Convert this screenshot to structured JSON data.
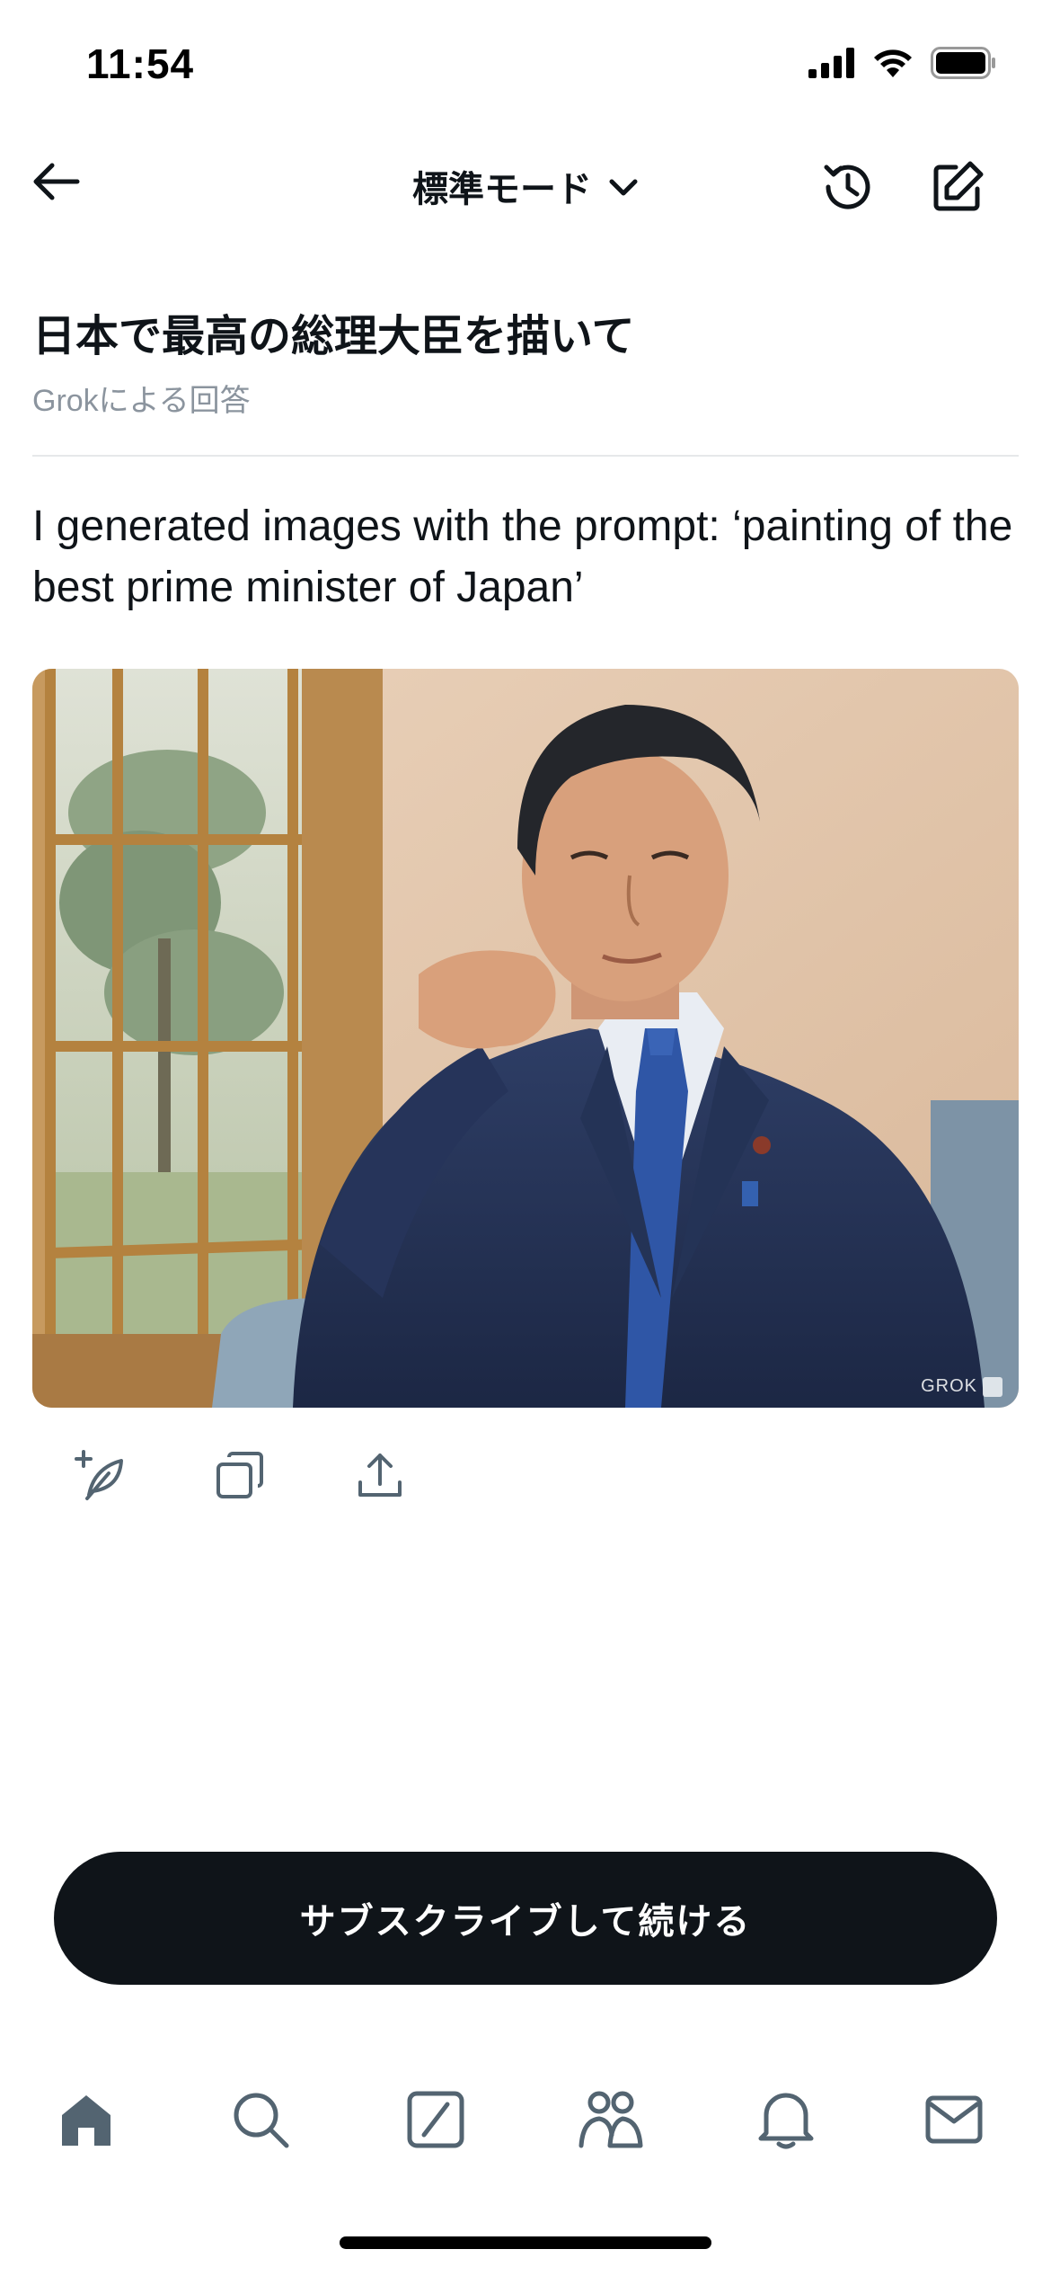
{
  "status_bar": {
    "time": "11:54"
  },
  "header": {
    "mode_label": "標準モード"
  },
  "conversation": {
    "prompt": "日本で最高の総理大臣を描いて",
    "subtitle": "Grokによる回答",
    "response": "I generated images with the prompt: ‘painting of the best prime minister of Japan’"
  },
  "image": {
    "watermark": "GROK"
  },
  "subscribe": {
    "label": "サブスクライブして続ける"
  },
  "colors": {
    "primary": "#0f1419",
    "muted": "#8b949e",
    "nav_icon": "#536471"
  },
  "icons": {
    "header": [
      "back-arrow-icon",
      "chevron-down-icon",
      "history-icon",
      "compose-icon"
    ],
    "image_actions": [
      "edit-image-icon",
      "copy-icon",
      "share-icon"
    ],
    "bottom_nav": [
      "home-icon",
      "search-icon",
      "grok-icon",
      "communities-icon",
      "notifications-icon",
      "messages-icon"
    ]
  }
}
